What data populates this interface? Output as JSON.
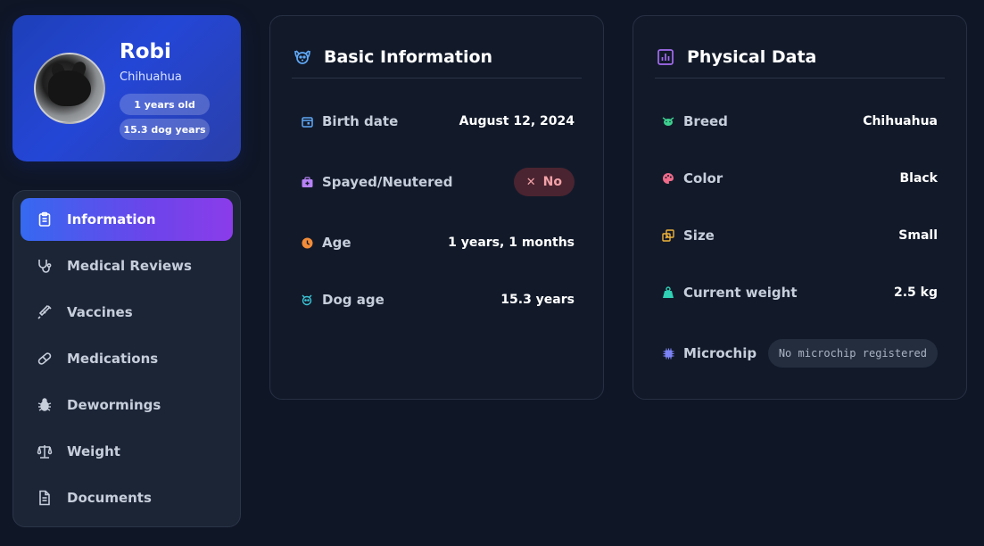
{
  "profile": {
    "name": "Robi",
    "breed": "Chihuahua",
    "age_pill": "1 years old",
    "dog_years_pill": "15.3 dog years"
  },
  "nav": {
    "items": [
      {
        "label": "Information",
        "icon": "clipboard-icon",
        "active": true
      },
      {
        "label": "Medical Reviews",
        "icon": "stethoscope-icon",
        "active": false
      },
      {
        "label": "Vaccines",
        "icon": "syringe-icon",
        "active": false
      },
      {
        "label": "Medications",
        "icon": "pill-icon",
        "active": false
      },
      {
        "label": "Dewormings",
        "icon": "bug-icon",
        "active": false
      },
      {
        "label": "Weight",
        "icon": "scale-icon",
        "active": false
      },
      {
        "label": "Documents",
        "icon": "document-icon",
        "active": false
      }
    ]
  },
  "basic": {
    "title": "Basic Information",
    "icon": "dog-icon",
    "rows": [
      {
        "label": "Birth date",
        "value": "August 12, 2024",
        "icon": "calendar-icon"
      },
      {
        "label": "Spayed/Neutered",
        "value": "No",
        "icon": "medkit-icon"
      },
      {
        "label": "Age",
        "value": "1 years, 1 months",
        "icon": "clock-icon"
      },
      {
        "label": "Dog age",
        "value": "15.3 years",
        "icon": "dog-face-icon"
      }
    ]
  },
  "physical": {
    "title": "Physical Data",
    "icon": "chart-icon",
    "rows": [
      {
        "label": "Breed",
        "value": "Chihuahua",
        "icon": "dog-face-icon"
      },
      {
        "label": "Color",
        "value": "Black",
        "icon": "palette-icon"
      },
      {
        "label": "Size",
        "value": "Small",
        "icon": "resize-icon"
      },
      {
        "label": "Current weight",
        "value": "2.5 kg",
        "icon": "weight-icon"
      },
      {
        "label": "Microchip",
        "value": "No microchip registered",
        "icon": "chip-icon"
      }
    ]
  },
  "colors": {
    "background": "#0f1626",
    "accent_blue": "#3569f0",
    "accent_purple": "#8b3cea",
    "no_badge_bg": "#4a2430",
    "no_badge_text": "#f2a2a8"
  }
}
